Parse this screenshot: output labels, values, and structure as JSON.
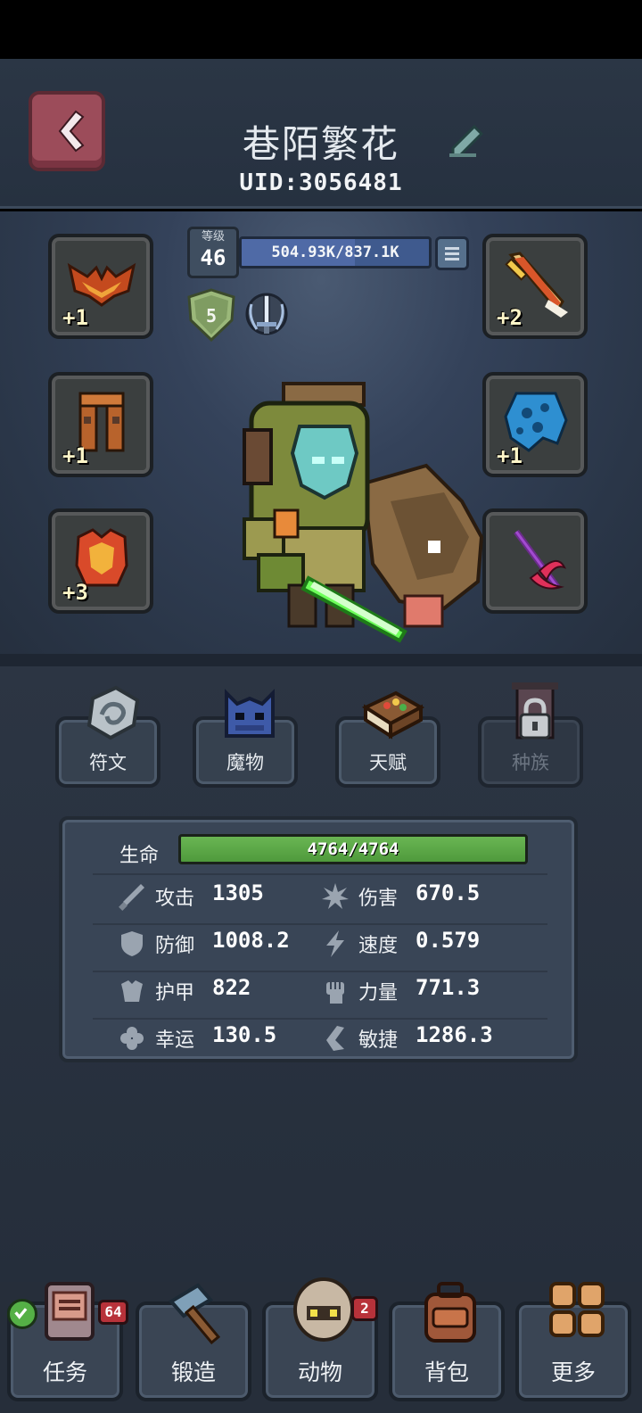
{
  "header": {
    "player_name": "巷陌繁花",
    "uid": "UID:3056481"
  },
  "level": {
    "label": "等级",
    "value": "46",
    "exp_text": "504.93K/837.1K",
    "exp_fraction": 0.603
  },
  "badges": {
    "shield_rank": "5"
  },
  "equipment": {
    "left": [
      {
        "name": "wings",
        "plus": "+1"
      },
      {
        "name": "pants",
        "plus": "+1"
      },
      {
        "name": "armor",
        "plus": "+3"
      }
    ],
    "right": [
      {
        "name": "sword",
        "plus": "+2"
      },
      {
        "name": "cape",
        "plus": "+1"
      },
      {
        "name": "staff",
        "plus": ""
      }
    ]
  },
  "tabs": [
    {
      "label": "符文",
      "locked": false
    },
    {
      "label": "魔物",
      "locked": false
    },
    {
      "label": "天赋",
      "locked": false
    },
    {
      "label": "种族",
      "locked": true
    }
  ],
  "stats": {
    "hp_label": "生命",
    "hp_text": "4764/4764",
    "hp_fraction": 1.0,
    "rows": [
      {
        "label": "攻击",
        "value": "1305",
        "icon": "sword-icon"
      },
      {
        "label": "伤害",
        "value": "670.5",
        "icon": "burst-icon"
      },
      {
        "label": "防御",
        "value": "1008.2",
        "icon": "shield-icon"
      },
      {
        "label": "速度",
        "value": "0.579",
        "icon": "lightning-icon"
      },
      {
        "label": "护甲",
        "value": "822",
        "icon": "armor-icon"
      },
      {
        "label": "力量",
        "value": "771.3",
        "icon": "fist-icon"
      },
      {
        "label": "幸运",
        "value": "130.5",
        "icon": "clover-icon"
      },
      {
        "label": "敏捷",
        "value": "1286.3",
        "icon": "boot-icon"
      }
    ]
  },
  "bottom_nav": [
    {
      "label": "任务",
      "badge": "64"
    },
    {
      "label": "锻造",
      "badge": ""
    },
    {
      "label": "动物",
      "badge": "2"
    },
    {
      "label": "背包",
      "badge": ""
    },
    {
      "label": "更多",
      "badge": ""
    }
  ],
  "colors": {
    "hp_green": "#69b553",
    "exp_blue": "#4f6aa6",
    "badge_red": "#b8323a",
    "back_button": "#9c4c5a"
  }
}
